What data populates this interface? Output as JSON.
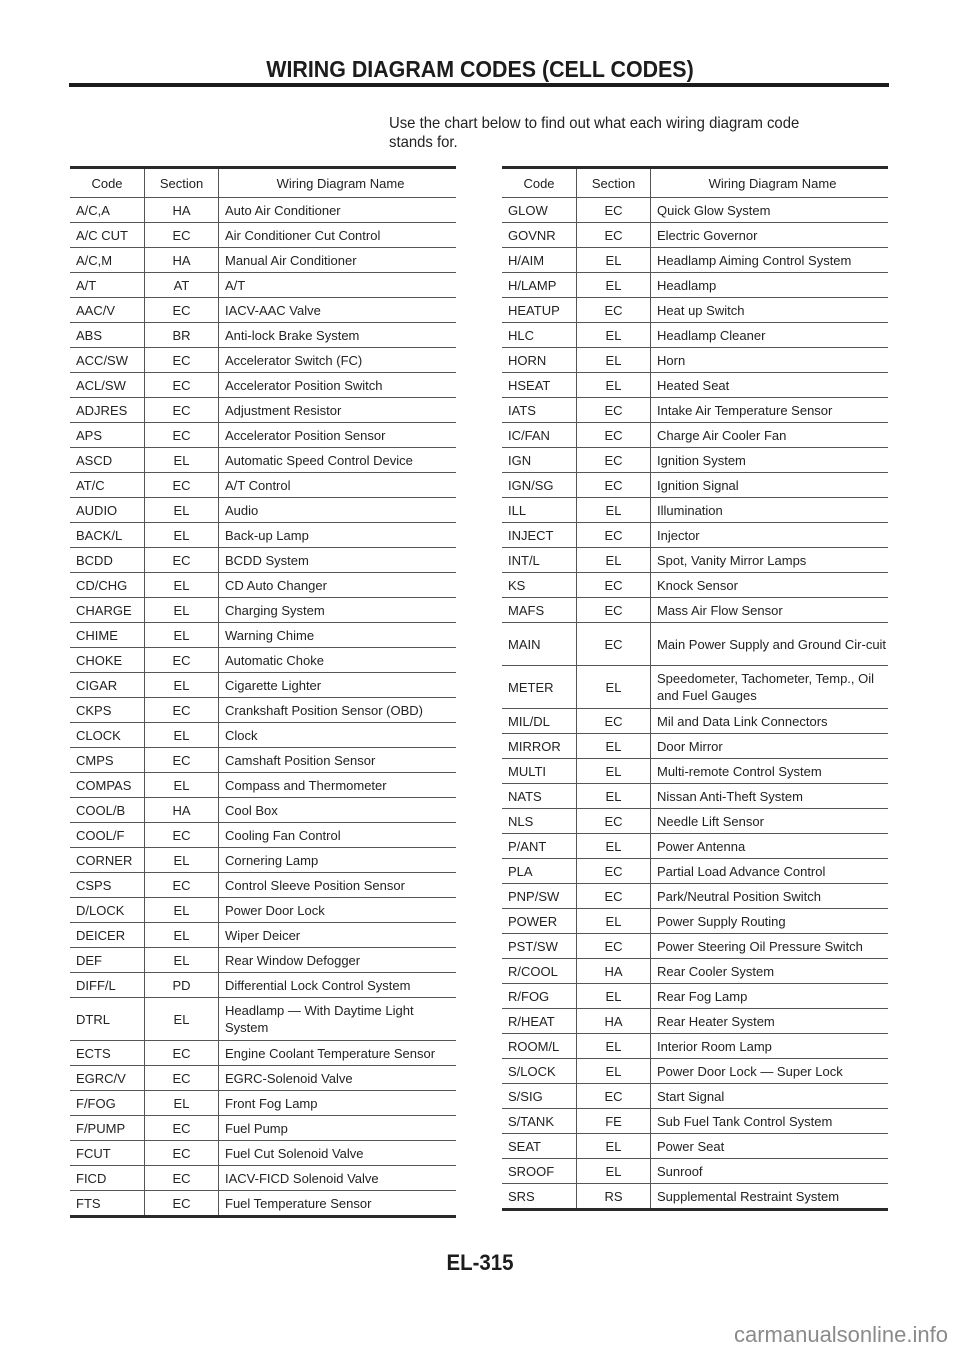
{
  "header": {
    "title": "WIRING DIAGRAM CODES (CELL CODES)"
  },
  "intro": {
    "line1": "Use the chart below to find out what each wiring diagram code",
    "line2": "stands for."
  },
  "table": {
    "columns": [
      "Code",
      "Section",
      "Wiring Diagram Name"
    ],
    "left_rows": [
      {
        "code": "A/C,A",
        "section": "HA",
        "name": "Auto Air Conditioner"
      },
      {
        "code": "A/C CUT",
        "section": "EC",
        "name": "Air Conditioner Cut Control"
      },
      {
        "code": "A/C,M",
        "section": "HA",
        "name": "Manual Air Conditioner"
      },
      {
        "code": "A/T",
        "section": "AT",
        "name": "A/T"
      },
      {
        "code": "AAC/V",
        "section": "EC",
        "name": "IACV-AAC Valve"
      },
      {
        "code": "ABS",
        "section": "BR",
        "name": "Anti-lock Brake System"
      },
      {
        "code": "ACC/SW",
        "section": "EC",
        "name": "Accelerator Switch (FC)"
      },
      {
        "code": "ACL/SW",
        "section": "EC",
        "name": "Accelerator Position Switch"
      },
      {
        "code": "ADJRES",
        "section": "EC",
        "name": "Adjustment Resistor"
      },
      {
        "code": "APS",
        "section": "EC",
        "name": "Accelerator Position Sensor"
      },
      {
        "code": "ASCD",
        "section": "EL",
        "name": "Automatic Speed Control Device"
      },
      {
        "code": "AT/C",
        "section": "EC",
        "name": "A/T Control"
      },
      {
        "code": "AUDIO",
        "section": "EL",
        "name": "Audio"
      },
      {
        "code": "BACK/L",
        "section": "EL",
        "name": "Back-up Lamp"
      },
      {
        "code": "BCDD",
        "section": "EC",
        "name": "BCDD System"
      },
      {
        "code": "CD/CHG",
        "section": "EL",
        "name": "CD Auto Changer"
      },
      {
        "code": "CHARGE",
        "section": "EL",
        "name": "Charging System"
      },
      {
        "code": "CHIME",
        "section": "EL",
        "name": "Warning Chime"
      },
      {
        "code": "CHOKE",
        "section": "EC",
        "name": "Automatic Choke"
      },
      {
        "code": "CIGAR",
        "section": "EL",
        "name": "Cigarette Lighter"
      },
      {
        "code": "CKPS",
        "section": "EC",
        "name": "Crankshaft Position Sensor (OBD)"
      },
      {
        "code": "CLOCK",
        "section": "EL",
        "name": "Clock"
      },
      {
        "code": "CMPS",
        "section": "EC",
        "name": "Camshaft Position Sensor"
      },
      {
        "code": "COMPAS",
        "section": "EL",
        "name": "Compass and Thermometer"
      },
      {
        "code": "COOL/B",
        "section": "HA",
        "name": "Cool Box"
      },
      {
        "code": "COOL/F",
        "section": "EC",
        "name": "Cooling Fan Control"
      },
      {
        "code": "CORNER",
        "section": "EL",
        "name": "Cornering Lamp"
      },
      {
        "code": "CSPS",
        "section": "EC",
        "name": "Control Sleeve Position Sensor"
      },
      {
        "code": "D/LOCK",
        "section": "EL",
        "name": "Power Door Lock"
      },
      {
        "code": "DEICER",
        "section": "EL",
        "name": "Wiper Deicer"
      },
      {
        "code": "DEF",
        "section": "EL",
        "name": "Rear Window Defogger"
      },
      {
        "code": "DIFF/L",
        "section": "PD",
        "name": "Differential Lock Control System"
      },
      {
        "code": "DTRL",
        "section": "EL",
        "name": "Headlamp — With Daytime Light System"
      },
      {
        "code": "ECTS",
        "section": "EC",
        "name": "Engine Coolant Temperature Sensor"
      },
      {
        "code": "EGRC/V",
        "section": "EC",
        "name": "EGRC-Solenoid Valve"
      },
      {
        "code": "F/FOG",
        "section": "EL",
        "name": "Front Fog Lamp"
      },
      {
        "code": "F/PUMP",
        "section": "EC",
        "name": "Fuel Pump"
      },
      {
        "code": "FCUT",
        "section": "EC",
        "name": "Fuel Cut Solenoid Valve"
      },
      {
        "code": "FICD",
        "section": "EC",
        "name": "IACV-FICD Solenoid Valve"
      },
      {
        "code": "FTS",
        "section": "EC",
        "name": "Fuel Temperature Sensor"
      }
    ],
    "right_rows": [
      {
        "code": "GLOW",
        "section": "EC",
        "name": "Quick Glow System"
      },
      {
        "code": "GOVNR",
        "section": "EC",
        "name": "Electric Governor"
      },
      {
        "code": "H/AIM",
        "section": "EL",
        "name": "Headlamp Aiming Control System"
      },
      {
        "code": "H/LAMP",
        "section": "EL",
        "name": "Headlamp"
      },
      {
        "code": "HEATUP",
        "section": "EC",
        "name": "Heat up Switch"
      },
      {
        "code": "HLC",
        "section": "EL",
        "name": "Headlamp Cleaner"
      },
      {
        "code": "HORN",
        "section": "EL",
        "name": "Horn"
      },
      {
        "code": "HSEAT",
        "section": "EL",
        "name": "Heated Seat"
      },
      {
        "code": "IATS",
        "section": "EC",
        "name": "Intake Air Temperature Sensor"
      },
      {
        "code": "IC/FAN",
        "section": "EC",
        "name": "Charge Air Cooler Fan"
      },
      {
        "code": "IGN",
        "section": "EC",
        "name": "Ignition System"
      },
      {
        "code": "IGN/SG",
        "section": "EC",
        "name": "Ignition Signal"
      },
      {
        "code": "ILL",
        "section": "EL",
        "name": "Illumination"
      },
      {
        "code": "INJECT",
        "section": "EC",
        "name": "Injector"
      },
      {
        "code": "INT/L",
        "section": "EL",
        "name": "Spot, Vanity Mirror Lamps"
      },
      {
        "code": "KS",
        "section": "EC",
        "name": "Knock Sensor"
      },
      {
        "code": "MAFS",
        "section": "EC",
        "name": "Mass Air Flow Sensor"
      },
      {
        "code": "MAIN",
        "section": "EC",
        "name": "Main Power Supply and Ground Cir-cuit"
      },
      {
        "code": "METER",
        "section": "EL",
        "name": "Speedometer, Tachometer, Temp., Oil and Fuel Gauges"
      },
      {
        "code": "MIL/DL",
        "section": "EC",
        "name": "Mil and Data Link Connectors"
      },
      {
        "code": "MIRROR",
        "section": "EL",
        "name": "Door Mirror"
      },
      {
        "code": "MULTI",
        "section": "EL",
        "name": "Multi-remote Control System"
      },
      {
        "code": "NATS",
        "section": "EL",
        "name": "Nissan Anti-Theft System"
      },
      {
        "code": "NLS",
        "section": "EC",
        "name": "Needle Lift Sensor"
      },
      {
        "code": "P/ANT",
        "section": "EL",
        "name": "Power Antenna"
      },
      {
        "code": "PLA",
        "section": "EC",
        "name": "Partial Load Advance Control"
      },
      {
        "code": "PNP/SW",
        "section": "EC",
        "name": "Park/Neutral Position Switch"
      },
      {
        "code": "POWER",
        "section": "EL",
        "name": "Power Supply Routing"
      },
      {
        "code": "PST/SW",
        "section": "EC",
        "name": "Power Steering Oil Pressure Switch"
      },
      {
        "code": "R/COOL",
        "section": "HA",
        "name": "Rear Cooler System"
      },
      {
        "code": "R/FOG",
        "section": "EL",
        "name": "Rear Fog Lamp"
      },
      {
        "code": "R/HEAT",
        "section": "HA",
        "name": "Rear Heater System"
      },
      {
        "code": "ROOM/L",
        "section": "EL",
        "name": "Interior Room Lamp"
      },
      {
        "code": "S/LOCK",
        "section": "EL",
        "name": "Power Door Lock — Super Lock"
      },
      {
        "code": "S/SIG",
        "section": "EC",
        "name": "Start Signal"
      },
      {
        "code": "S/TANK",
        "section": "FE",
        "name": "Sub Fuel Tank Control System"
      },
      {
        "code": "SEAT",
        "section": "EL",
        "name": "Power Seat"
      },
      {
        "code": "SROOF",
        "section": "EL",
        "name": "Sunroof"
      },
      {
        "code": "SRS",
        "section": "RS",
        "name": "Supplemental Restraint System"
      }
    ]
  },
  "footer": {
    "page_number": "EL-315",
    "watermark": "carmanualsonline.info"
  }
}
